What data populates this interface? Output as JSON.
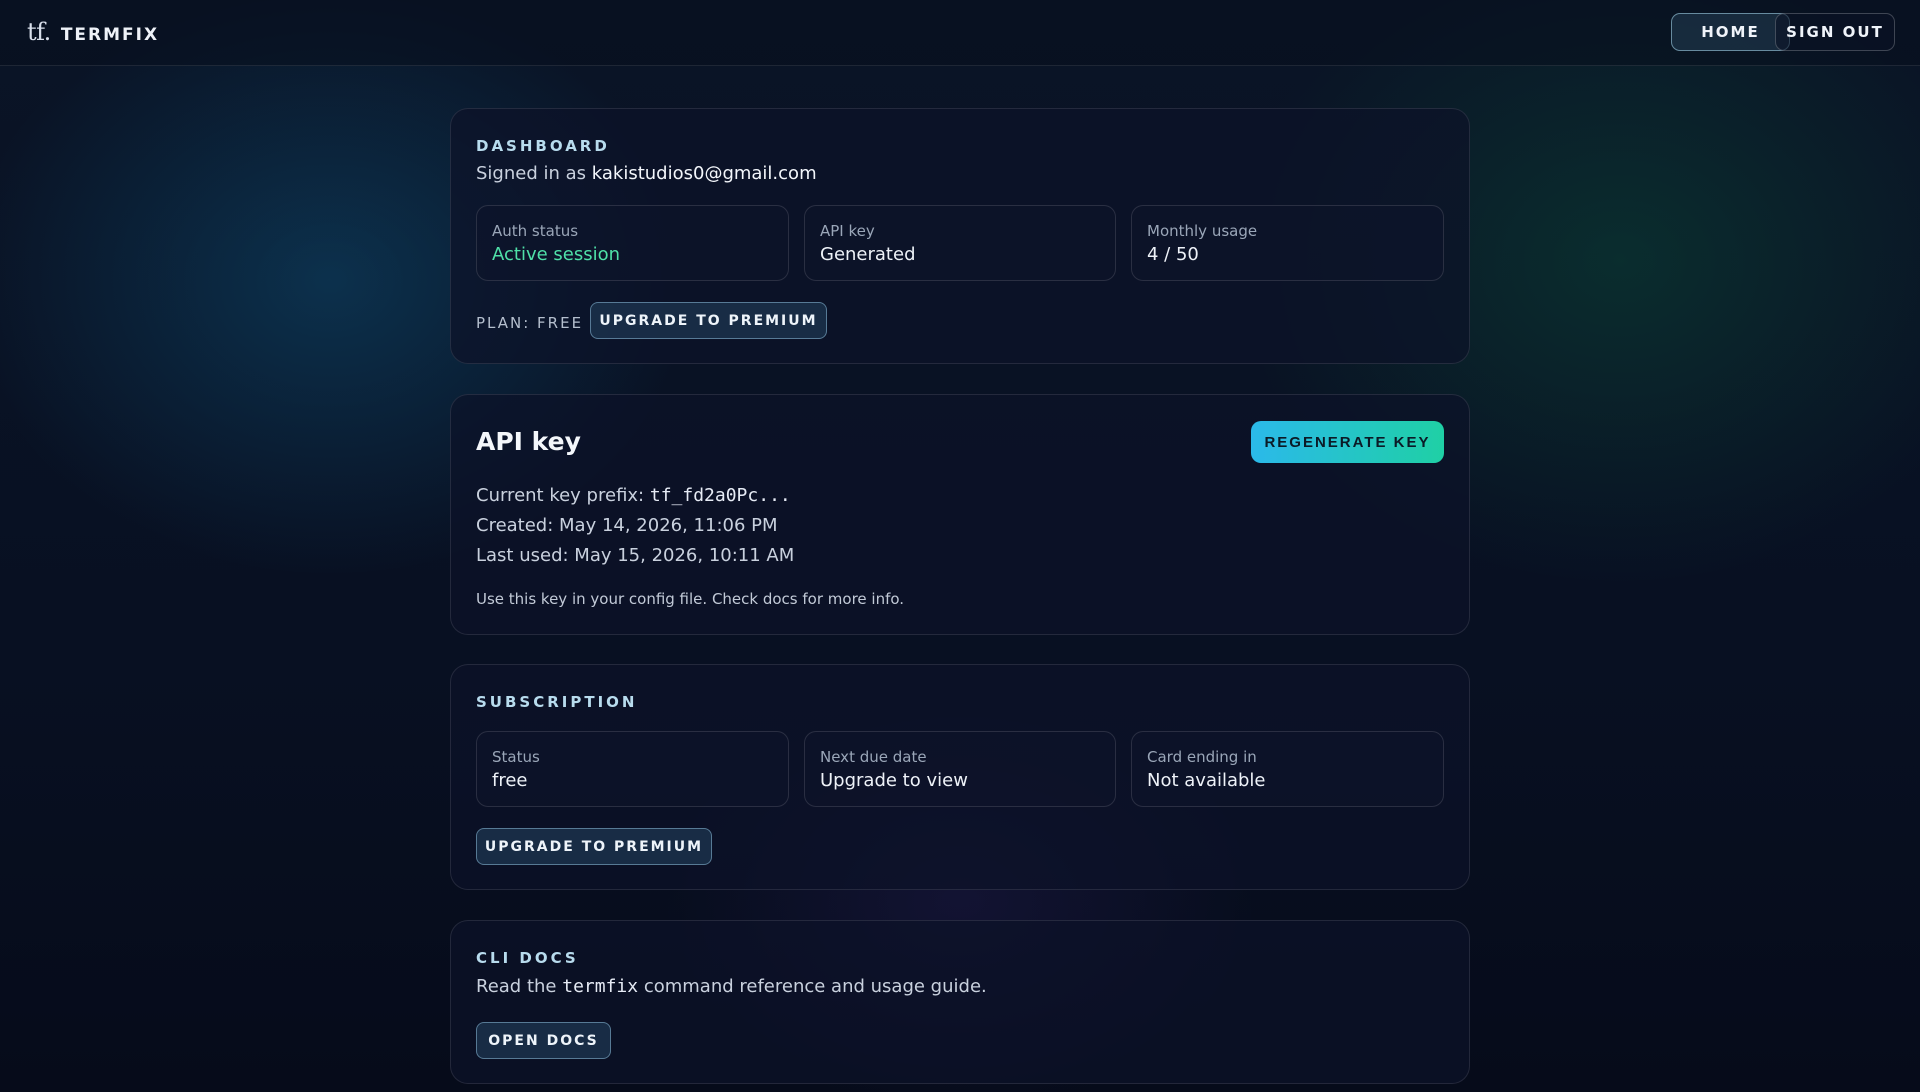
{
  "header": {
    "logo_mark": "tf.",
    "brand_name": "TERMFIX",
    "nav": {
      "home_label": "HOME",
      "signout_label": "SIGN OUT"
    }
  },
  "dashboard": {
    "eyebrow": "DASHBOARD",
    "signed_in_prefix": "Signed in as",
    "email": "kakistudios0@gmail.com",
    "stats": [
      {
        "label": "Auth status",
        "value": "Active session"
      },
      {
        "label": "API key",
        "value": "Generated"
      },
      {
        "label": "Monthly usage",
        "value": "4 / 50"
      }
    ],
    "plan_label": "PLAN: FREE",
    "upgrade_label": "UPGRADE TO PREMIUM"
  },
  "api_key": {
    "title": "API key",
    "regenerate_label": "REGENERATE KEY",
    "prefix_label": "Current key prefix:",
    "prefix_value": "tf_fd2a0Pc...",
    "created": "Created: May 14, 2026, 11:06 PM",
    "last_used": "Last used: May 15, 2026, 10:11 AM",
    "note": "Use this key in your config file. Check docs for more info."
  },
  "subscription": {
    "eyebrow": "SUBSCRIPTION",
    "stats": [
      {
        "label": "Status",
        "value": "free"
      },
      {
        "label": "Next due date",
        "value": "Upgrade to view"
      },
      {
        "label": "Card ending in",
        "value": "Not available"
      }
    ],
    "upgrade_label": "UPGRADE TO PREMIUM"
  },
  "cli_docs": {
    "eyebrow": "CLI DOCS",
    "text_before": "Read the",
    "command": "termfix",
    "text_after": "command reference and usage guide.",
    "open_label": "OPEN DOCS"
  },
  "colors": {
    "accent_gradient_start": "#2bb9ea",
    "accent_gradient_end": "#1fd0a5",
    "status_ok": "#4fe0a8"
  }
}
